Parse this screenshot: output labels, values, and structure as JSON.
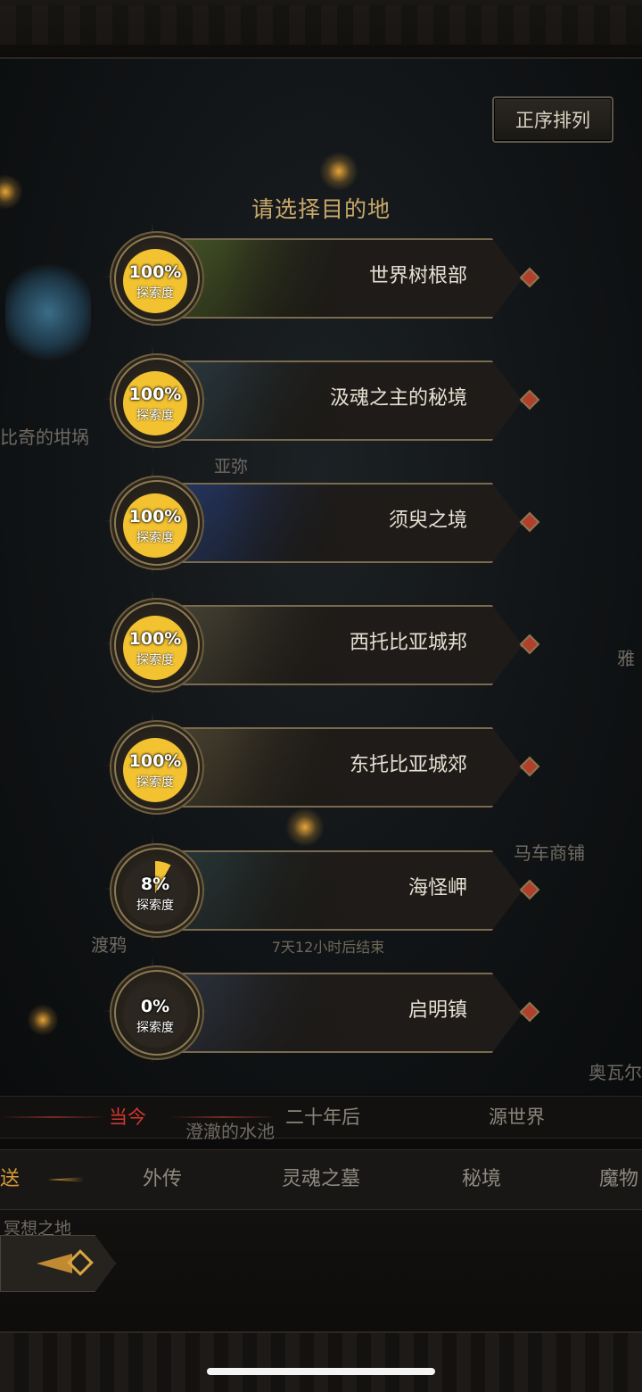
{
  "sort_button": "正序排列",
  "prompt": "请选择目的地",
  "explore_label": "探索度",
  "destinations": [
    {
      "name": "世界树根部",
      "progress": "100%",
      "fraction": 1.0,
      "scene_color": "#4a5a2a"
    },
    {
      "name": "汲魂之主的秘境",
      "progress": "100%",
      "fraction": 1.0,
      "scene_color": "#2c3c44"
    },
    {
      "name": "须臾之境",
      "progress": "100%",
      "fraction": 1.0,
      "scene_color": "#263a6a"
    },
    {
      "name": "西托比亚城邦",
      "progress": "100%",
      "fraction": 1.0,
      "scene_color": "#4a4638"
    },
    {
      "name": "东托比亚城郊",
      "progress": "100%",
      "fraction": 1.0,
      "scene_color": "#4e4634"
    },
    {
      "name": "海怪岬",
      "progress": "8%",
      "fraction": 0.08,
      "scene_color": "#2a3a3c"
    },
    {
      "name": "启明镇",
      "progress": "0%",
      "fraction": 0.0,
      "scene_color": "#2e3440"
    }
  ],
  "timer": "7天12小时后结束",
  "map_labels": {
    "l1": "比奇的坩埚",
    "l2": "亚弥",
    "l3": "雅",
    "l4": "马车商铺",
    "l5": "渡鸦",
    "l6": "奥瓦尔",
    "l7": "澄澈的水池",
    "l8": "冥想之地"
  },
  "eras": [
    "当今",
    "二十年后",
    "源世界"
  ],
  "tabs": [
    "传送",
    "外传",
    "灵魂之墓",
    "秘境",
    "魔物"
  ],
  "colors": {
    "accent_red": "#d0362c",
    "gold": "#d79a3a",
    "progress_gold": "#f2c230"
  }
}
